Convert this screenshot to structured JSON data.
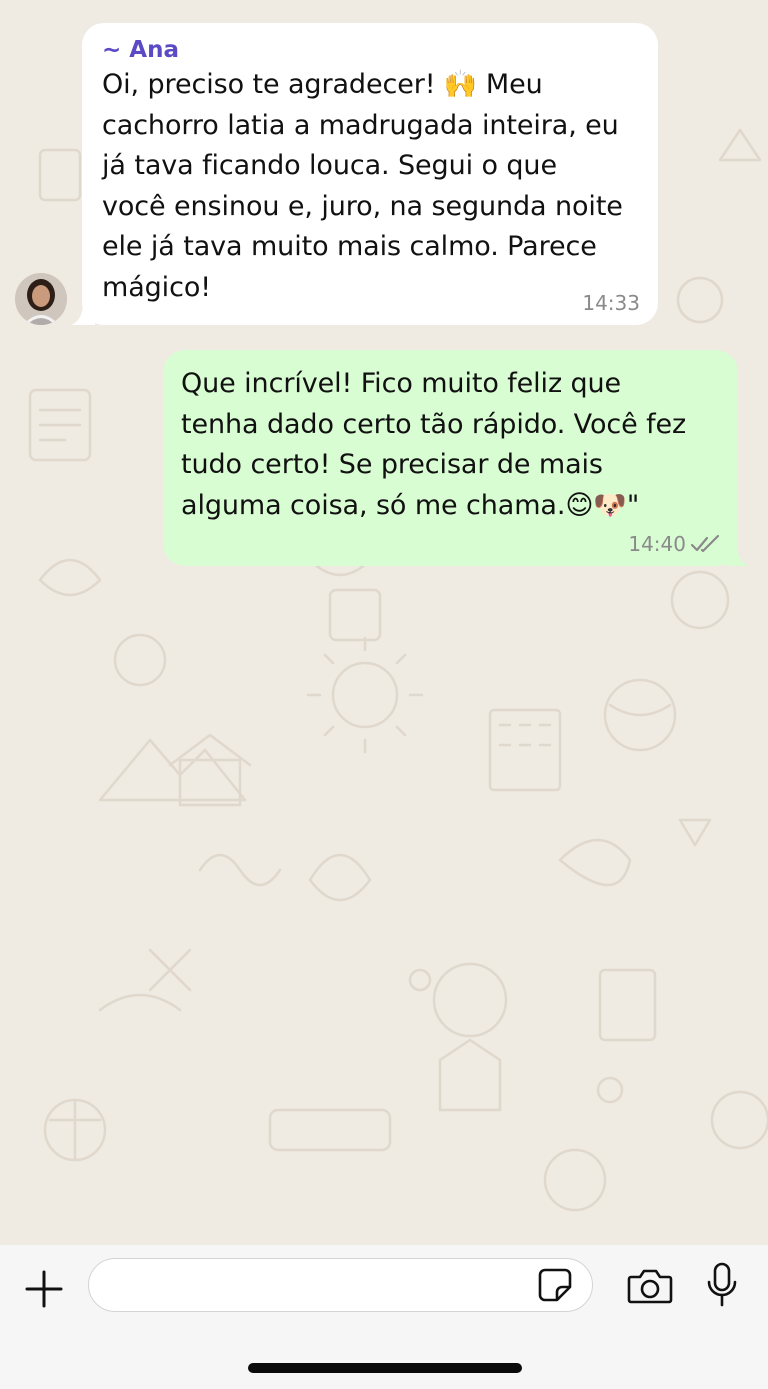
{
  "conversation": {
    "incoming": {
      "sender": "~ Ana",
      "lines": [
        "Oi, preciso te agradecer! 🙌 Meu",
        "cachorro latia a madrugada inteira, eu",
        "já tava ficando louca. Segui o que",
        "você ensinou e, juro, na segunda noite",
        "ele já tava muito mais calmo. Parece",
        "mágico!"
      ],
      "time": "14:33",
      "avatar_icon": "contact-avatar"
    },
    "outgoing": {
      "lines": [
        "Que incrível! Fico muito feliz que",
        "tenha dado certo tão rápido. Você fez",
        "tudo certo! Se precisar de mais",
        "alguma coisa, só me chama.😊🐶\""
      ],
      "time": "14:40",
      "status_icon": "double-check-read-icon"
    }
  },
  "composer": {
    "placeholder": "",
    "value": "",
    "icons": [
      "plus-icon",
      "sticker-icon",
      "camera-icon",
      "microphone-icon"
    ]
  },
  "colors": {
    "chat_background": "#efeae2",
    "incoming_bubble": "#ffffff",
    "outgoing_bubble": "#d9fdd3",
    "sender_name": "#5a4ac4",
    "timestamp": "#8a8a8a"
  }
}
